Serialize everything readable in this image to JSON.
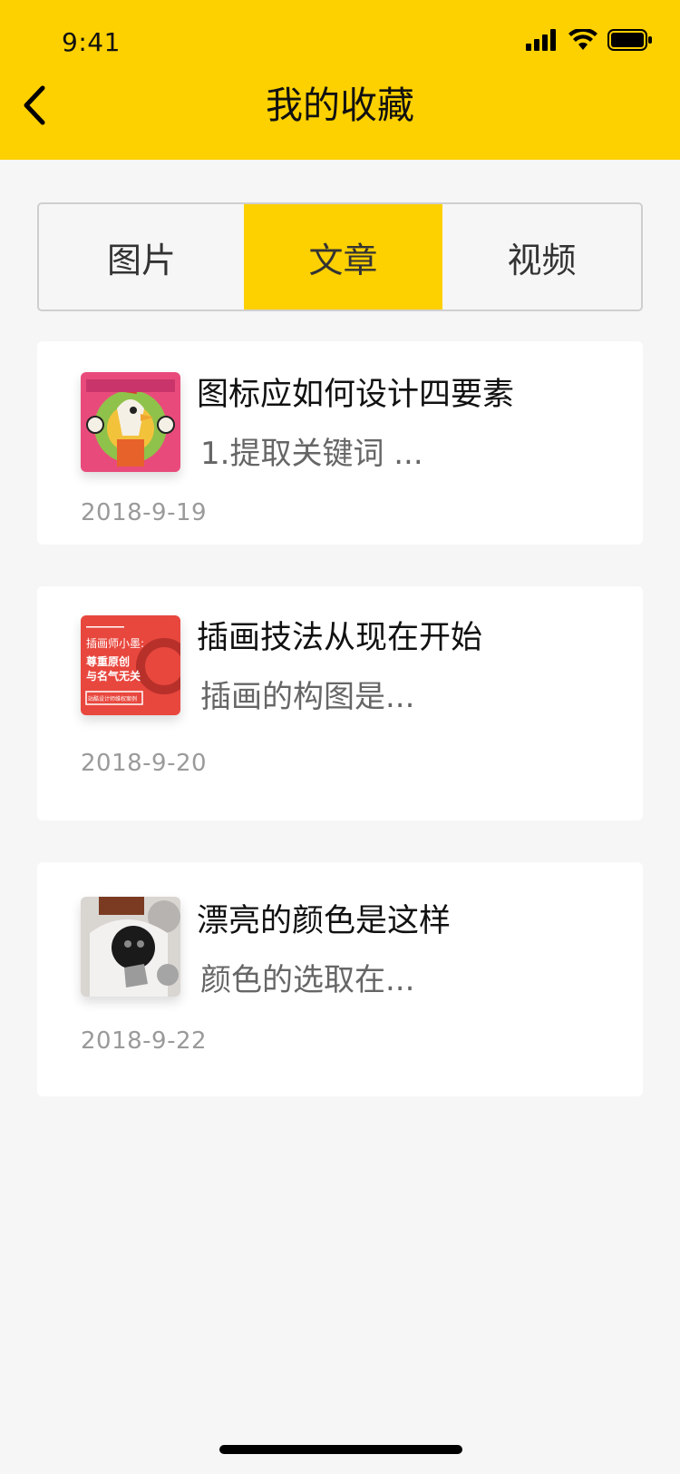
{
  "status_bar": {
    "time": "9:41"
  },
  "nav": {
    "title": "我的收藏"
  },
  "tabs": [
    {
      "label": "图片",
      "selected": false
    },
    {
      "label": "文章",
      "selected": true
    },
    {
      "label": "视频",
      "selected": false
    }
  ],
  "articles": [
    {
      "title": "图标应如何设计四要素",
      "excerpt": "1.提取关键词 ...",
      "date": "2018-9-19"
    },
    {
      "title": "插画技法从现在开始",
      "excerpt": "插画的构图是...",
      "date": "2018-9-20",
      "thumb_text": {
        "line1": "插画师小墨:",
        "line2": "尊重原创",
        "line3": "与名气无关",
        "line4": "站酷设计师维权案例"
      }
    },
    {
      "title": "漂亮的颜色是这样",
      "excerpt": "颜色的选取在...",
      "date": "2018-9-22"
    }
  ],
  "colors": {
    "accent": "#fdd000",
    "background": "#f6f6f6",
    "card": "#ffffff"
  }
}
